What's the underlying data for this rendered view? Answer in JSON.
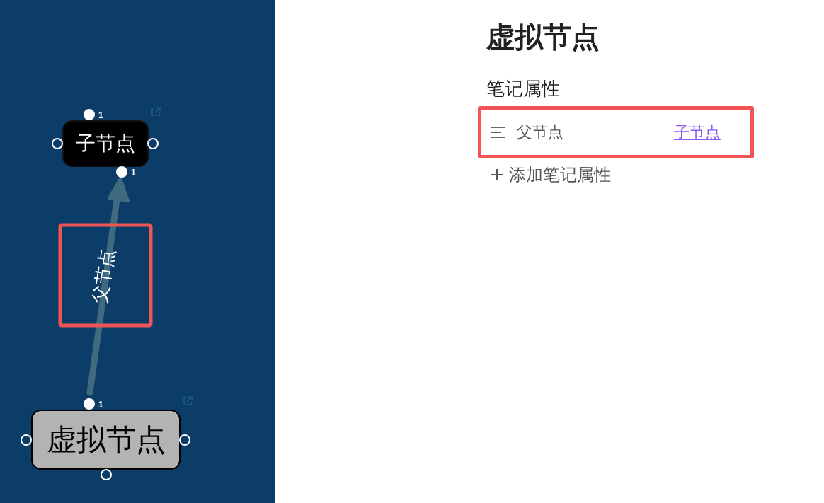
{
  "graph": {
    "nodes": [
      {
        "label": "子节点",
        "kind": "dark",
        "top_count": "1",
        "bottom_count": "1"
      },
      {
        "label": "虚拟节点",
        "kind": "light",
        "top_count": "1"
      }
    ],
    "edge": {
      "label": "父节点",
      "highlighted": true
    }
  },
  "note": {
    "title": "虚拟节点",
    "section": "笔记属性",
    "properties": [
      {
        "name": "父节点",
        "value": "子节点",
        "highlighted": true
      }
    ],
    "add_button": "添加笔记属性"
  }
}
